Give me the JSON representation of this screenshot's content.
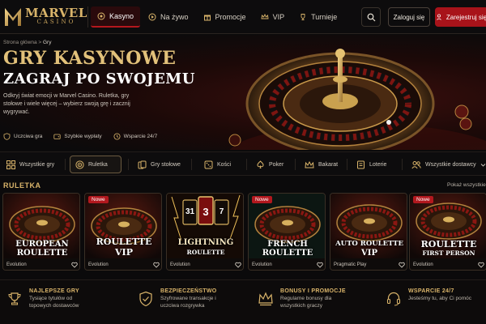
{
  "brand": {
    "name": "MARVEL",
    "sub": "CASINO"
  },
  "nav": {
    "links": [
      {
        "label": "Kasyno",
        "icon": "casino-chip-icon",
        "active": true
      },
      {
        "label": "Na żywo",
        "icon": "live-icon",
        "active": false
      },
      {
        "label": "Promocje",
        "icon": "gift-icon",
        "active": false
      },
      {
        "label": "VIP",
        "icon": "crown-icon",
        "active": false
      },
      {
        "label": "Turnieje",
        "icon": "trophy-icon",
        "active": false
      }
    ],
    "login": "Zaloguj się",
    "register": "Zarejestruj się"
  },
  "hero": {
    "breadcrumb": {
      "home": "Strona główna",
      "sep": ">",
      "current": "Gry"
    },
    "title": "GRY KASYNOWE",
    "subtitle": "ZAGRAJ PO SWOJEMU",
    "description": "Odkryj świat emocji w Marvel Casino. Ruletka, gry stołowe i wiele więcej – wybierz swoją grę i zacznij wygrywać.",
    "features": [
      "Uczciwa gra",
      "Szybkie wypłaty",
      "Wsparcie 24/7"
    ]
  },
  "categories": [
    {
      "label": "Wszystkie gry",
      "icon": "grid-icon",
      "active": false
    },
    {
      "label": "Ruletka",
      "icon": "roulette-icon",
      "active": true
    },
    {
      "label": "Gry stołowe",
      "icon": "cards-icon",
      "active": false
    },
    {
      "label": "Kości",
      "icon": "dice-icon",
      "active": false
    },
    {
      "label": "Poker",
      "icon": "spade-icon",
      "active": false
    },
    {
      "label": "Bakarat",
      "icon": "crown-icon",
      "active": false
    },
    {
      "label": "Loterie",
      "icon": "ticket-icon",
      "active": false
    },
    {
      "label": "Wszystkie dostawcy",
      "icon": "people-icon",
      "active": false
    }
  ],
  "section": {
    "title": "RULETKA",
    "show_all": "Pokaż wszystkie"
  },
  "games": [
    {
      "line1": "EUROPEAN",
      "line2": "ROULETTE",
      "provider": "Evolution",
      "badge": ""
    },
    {
      "line1": "ROULETTE",
      "line2": "VIP",
      "provider": "Evolution",
      "badge": "Nowe"
    },
    {
      "line1": "LIGHTNING",
      "line2": "ROULETTE",
      "provider": "Evolution",
      "badge": "",
      "numbers": [
        "31",
        "3",
        "7"
      ]
    },
    {
      "line1": "FRENCH",
      "line2": "ROULETTE",
      "provider": "Evolution",
      "badge": "Nowe"
    },
    {
      "line1": "AUTO ROULETTE",
      "line2": "VIP",
      "provider": "Pragmatic Play",
      "badge": ""
    },
    {
      "line1": "ROULETTE",
      "line2": "FIRST PERSON",
      "provider": "Evolution",
      "badge": "Nowe"
    }
  ],
  "benefits": [
    {
      "title": "NAJLEPSZE GRY",
      "desc": "Tysiące tytułów od topowych dostawców",
      "icon": "trophy-icon"
    },
    {
      "title": "BEZPIECZEŃSTWO",
      "desc": "Szyfrowane transakcje i uczciwa rozgrywka",
      "icon": "shield-check-icon"
    },
    {
      "title": "BONUSY I PROMOCJE",
      "desc": "Regularne bonusy dla wszystkich graczy",
      "icon": "crown-icon"
    },
    {
      "title": "WSPARCIE 24/7",
      "desc": "Jesteśmy tu, aby Ci pomóc",
      "icon": "headset-icon"
    }
  ],
  "colors": {
    "gold": "#d9b46a",
    "red": "#a8131a",
    "bg": "#0b0a0b"
  }
}
